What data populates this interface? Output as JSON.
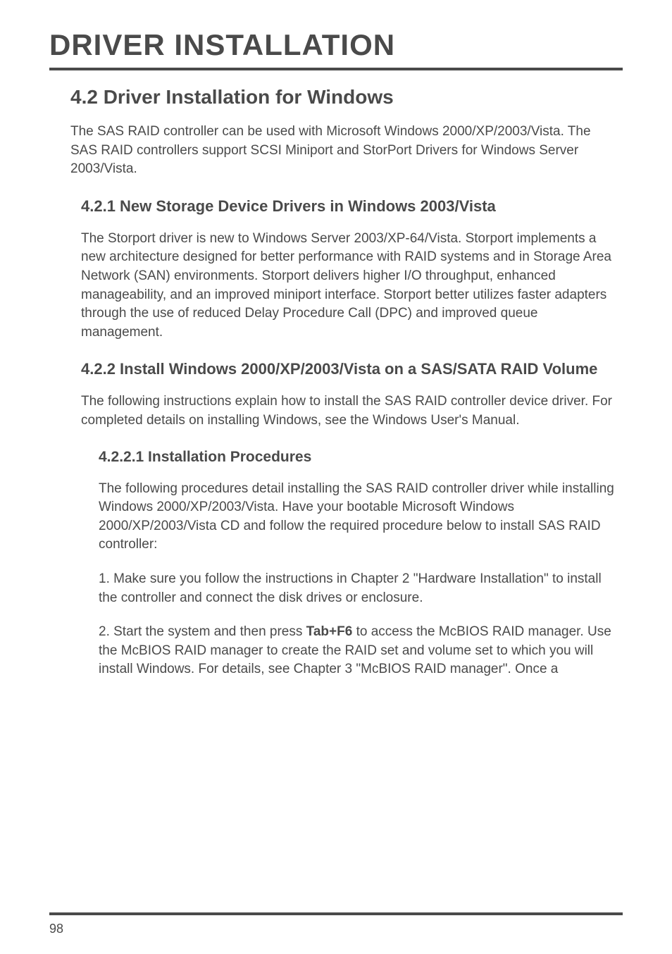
{
  "page": {
    "title": "DRIVER INSTALLATION",
    "pageNumber": "98"
  },
  "section": {
    "heading": "4.2 Driver Installation for Windows",
    "intro": "The SAS RAID controller can be used with Microsoft Windows 2000/XP/2003/Vista. The SAS RAID controllers support SCSI Miniport and StorPort Drivers for Windows Server 2003/Vista."
  },
  "subsection1": {
    "heading": "4.2.1 New Storage Device Drivers in Windows 2003/Vista",
    "text": "The Storport driver is new to Windows Server 2003/XP-64/Vista. Storport implements a new architecture designed for better performance with RAID systems and in Storage Area Network (SAN) environments. Storport delivers higher I/O throughput, enhanced manageability, and an improved miniport interface. Storport better utilizes faster adapters through the use of reduced Delay Procedure Call (DPC) and improved queue management."
  },
  "subsection2": {
    "heading": "4.2.2 Install Windows 2000/XP/2003/Vista on a SAS/SATA RAID Volume",
    "text": "The following instructions explain how to install the SAS RAID controller device driver. For completed details on installing Windows, see the Windows User's Manual."
  },
  "subsubsection": {
    "heading": "4.2.2.1 Installation Procedures",
    "para1": "The following procedures detail installing the SAS RAID controller driver while installing Windows 2000/XP/2003/Vista. Have your bootable Microsoft Windows 2000/XP/2003/Vista CD and follow the required procedure below to install SAS RAID controller:",
    "para2": "1. Make sure you follow the instructions in Chapter 2 \"Hardware Installation\" to install the controller and connect the disk drives or enclosure.",
    "para3_before": "2. Start the system and then press ",
    "para3_bold": "Tab+F6",
    "para3_after": " to access the McBIOS RAID manager.  Use the McBIOS RAID manager to create the RAID set and volume set to which you will install Windows. For details, see Chapter 3 \"McBIOS RAID manager\". Once a"
  }
}
